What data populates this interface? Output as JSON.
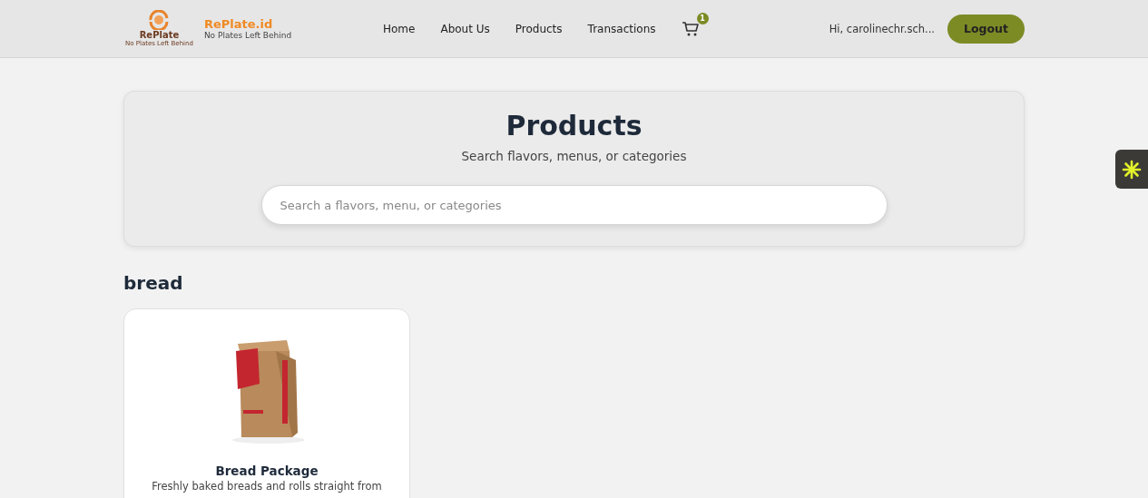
{
  "logo": {
    "name": "RePlate",
    "tagline": "No Plates Left Behind"
  },
  "brand": {
    "title": "RePlate.id",
    "subtitle": "No Plates Left Behind"
  },
  "nav": [
    "Home",
    "About Us",
    "Products",
    "Transactions"
  ],
  "cart": {
    "count": "1"
  },
  "user": {
    "greeting": "Hi, carolinechr.sch...",
    "logout": "Logout"
  },
  "hero": {
    "title": "Products",
    "subtitle": "Search flavors, menus, or categories",
    "search": {
      "placeholder": "Search a flavors, menu, or categories"
    }
  },
  "sections": [
    {
      "title": "bread",
      "products": [
        {
          "name": "Bread Package",
          "description": "Freshly baked breads and rolls straight from"
        }
      ]
    }
  ]
}
